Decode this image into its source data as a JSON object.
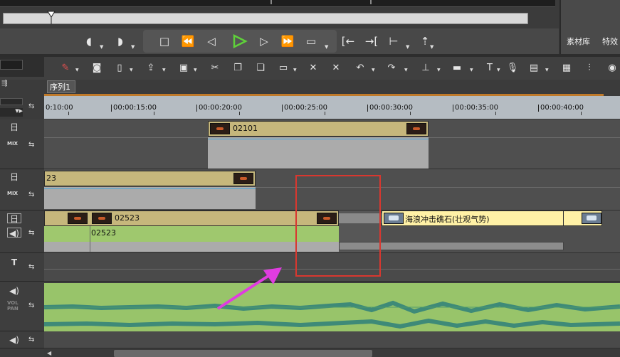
{
  "transport": {
    "buttons": [
      "mark-in",
      "mark-out",
      "stop",
      "rewind",
      "step-back",
      "play",
      "step-forward",
      "fast-forward",
      "loop"
    ],
    "icons": {
      "play_color": "#5fd13a"
    }
  },
  "right_panel": {
    "tabs": [
      "素材库",
      "特效"
    ]
  },
  "sequence": {
    "tab_label": "序列1"
  },
  "ruler": {
    "labels": [
      "0:10:00",
      "00:00:15:00",
      "00:00:20:00",
      "00:00:25:00",
      "00:00:30:00",
      "00:00:35:00",
      "00:00:40:00"
    ]
  },
  "tracks": {
    "mix_label": "MIX",
    "title_label": "T",
    "vol_pan_label": "VOL PAN",
    "v1_clip": "02101",
    "v2_clip": "23",
    "va_clip_top": "02523",
    "va_clip_audio": "02523",
    "va_clip_sea": "海浪冲击礁石(壮观气势)"
  },
  "colors": {
    "clip_gold": "#c6b77c",
    "clip_gray": "#ababab",
    "audio_green": "#9fc86e",
    "highlight_red": "#d9372f",
    "arrow_magenta": "#e03ce0",
    "sequence_line": "#c07a2a"
  }
}
